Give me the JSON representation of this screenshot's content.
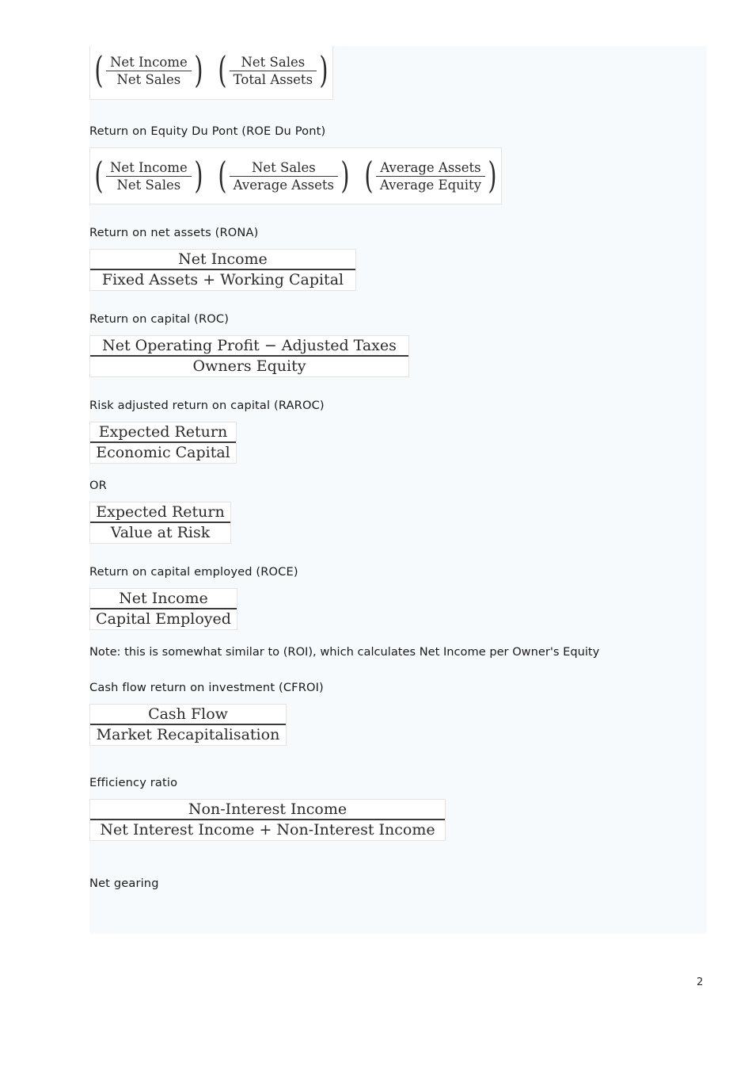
{
  "document": {
    "page_number": "2",
    "page_background": "#f7fafd",
    "text_color": "#1a1a1a",
    "formula_border_color": "#e3e3e3"
  },
  "blocks": {
    "roa_dupont_formula": {
      "type": "product-of-fractions",
      "factors": [
        {
          "numerator": "Net Income",
          "denominator": "Net Sales"
        },
        {
          "numerator": "Net Sales",
          "denominator": "Total Assets"
        }
      ]
    },
    "roe_dupont_label": "Return on Equity Du Pont (ROE Du Pont)",
    "roe_dupont_formula": {
      "type": "product-of-fractions",
      "factors": [
        {
          "numerator": "Net Income",
          "denominator": "Net Sales"
        },
        {
          "numerator": "Net Sales",
          "denominator": "Average Assets"
        },
        {
          "numerator": "Average Assets",
          "denominator": "Average Equity"
        }
      ]
    },
    "rona_label": "Return on net assets (RONA)",
    "rona_formula": {
      "numerator": "Net Income",
      "denominator": "Fixed Assets + Working Capital"
    },
    "roc_label": "Return on capital (ROC)",
    "roc_formula": {
      "numerator": "Net Operating Profit − Adjusted Taxes",
      "denominator": "Owners Equity"
    },
    "raroc_label": "Risk adjusted return on capital (RAROC)",
    "raroc_formula_1": {
      "numerator": "Expected Return",
      "denominator": "Economic Capital"
    },
    "raroc_or_label": "OR",
    "raroc_formula_2": {
      "numerator": "Expected Return",
      "denominator": "Value at Risk"
    },
    "roce_label": "Return on capital employed (ROCE)",
    "roce_formula": {
      "numerator": "Net Income",
      "denominator": "Capital Employed"
    },
    "roce_note": "Note: this is somewhat similar to (ROI), which calculates Net Income per Owner's Equity",
    "cfroi_label": "Cash flow return on investment (CFROI)",
    "cfroi_formula": {
      "numerator": "Cash Flow",
      "denominator": "Market Recapitalisation"
    },
    "efficiency_label": "Efficiency ratio",
    "efficiency_formula": {
      "numerator": "Non-Interest Income",
      "denominator": "Net Interest Income + Non-Interest Income"
    },
    "net_gearing_label": "Net gearing"
  }
}
